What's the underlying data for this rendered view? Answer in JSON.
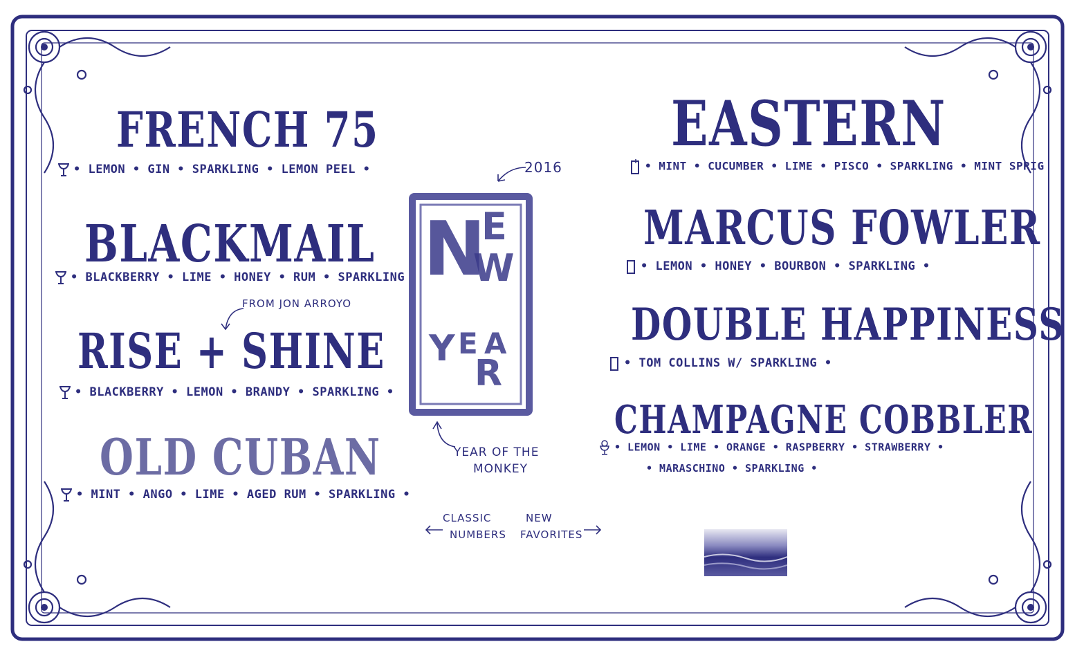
{
  "colors": {
    "ink": "#2e2e7e",
    "paper": "#ffffff",
    "frame": "#2e2e7e"
  },
  "left": [
    {
      "name": "FRENCH 75",
      "ingredients": "• LEMON • GIN • SPARKLING • LEMON PEEL •",
      "icon": "coupe-glass-icon"
    },
    {
      "name": "BLACKMAIL",
      "ingredients": "• BLACKBERRY • LIME • HONEY • RUM • SPARKLING",
      "icon": "coupe-glass-icon"
    },
    {
      "name": "RISE + SHINE",
      "note": "FROM JON ARROYO",
      "ingredients": "• BLACKBERRY • LEMON • BRANDY • SPARKLING •",
      "icon": "coupe-glass-icon"
    },
    {
      "name": "OLD CUBAN",
      "ingredients": "• MINT • ANGO • LIME • AGED RUM • SPARKLING •",
      "icon": "coupe-glass-icon"
    }
  ],
  "right": [
    {
      "name": "EASTERN",
      "ingredients": "• MINT • CUCUMBER • LIME • PISCO • SPARKLING • MINT SPRIG",
      "icon": "collins-glass-icon"
    },
    {
      "name": "MARCUS FOWLER",
      "ingredients": "• LEMON • HONEY • BOURBON • SPARKLING •",
      "icon": "collins-glass-icon"
    },
    {
      "name": "DOUBLE HAPPINESS",
      "ingredients": "• TOM COLLINS W/ SPARKLING •",
      "icon": "collins-glass-icon"
    },
    {
      "name": "CHAMPAGNE COBBLER",
      "ingredients": "• LEMON • LIME • ORANGE • RASPBERRY • STRAWBERRY •",
      "ingredients2": "• MARASCHINO • SPARKLING •",
      "icon": "cobbler-glass-icon"
    }
  ],
  "center": {
    "year": "2016",
    "letters_top": [
      "N",
      "E",
      "W"
    ],
    "letters_bottom": [
      "Y",
      "E",
      "A",
      "R"
    ],
    "caption": [
      "YEAR OF THE",
      "MONKEY"
    ]
  },
  "footer": {
    "classic": [
      "CLASSIC",
      "NUMBERS"
    ],
    "new": [
      "NEW",
      "FAVORITES"
    ]
  }
}
